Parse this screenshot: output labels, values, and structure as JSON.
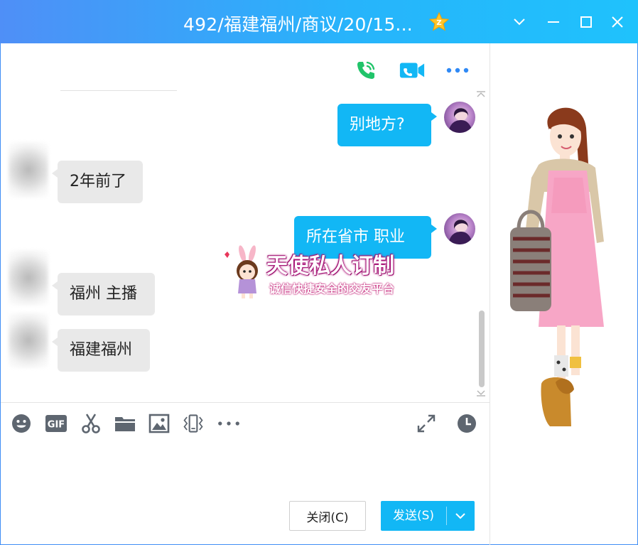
{
  "window": {
    "title": "492/福建福州/商议/20/15...",
    "accent": "#12b7f5",
    "controls": [
      "chevron-down-icon",
      "minimize-icon",
      "maximize-icon",
      "close-icon"
    ]
  },
  "header_actions": [
    "phone-call-icon",
    "video-call-icon",
    "more-icon"
  ],
  "messages": [
    {
      "side": "right",
      "text": "别地方?"
    },
    {
      "side": "left",
      "text": "2年前了"
    },
    {
      "side": "right",
      "text": "所在省市  职业"
    },
    {
      "side": "left",
      "text": "福州 主播"
    },
    {
      "side": "left",
      "text": "福建福州"
    }
  ],
  "watermark": {
    "title": "天使私人订制",
    "subtitle": "诚信快捷安全的交友平台"
  },
  "toolbar": [
    "emoji-icon",
    "gif-icon",
    "screenshot-scissors-icon",
    "folder-icon",
    "image-icon",
    "shake-window-icon",
    "more-tools-icon",
    "expand-icon",
    "history-clock-icon"
  ],
  "toolbar_labels": {
    "gif": "GIF"
  },
  "footer": {
    "close_label": "关闭(C)",
    "send_label": "发送(S)"
  }
}
